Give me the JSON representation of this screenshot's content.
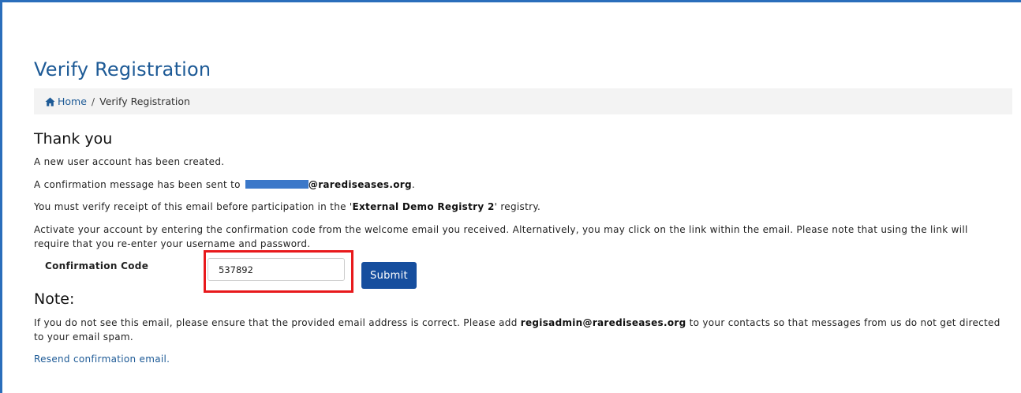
{
  "page": {
    "title": "Verify Registration"
  },
  "breadcrumb": {
    "home_label": "Home",
    "separator": "/",
    "current_label": "Verify Registration"
  },
  "thank_you": {
    "heading": "Thank you",
    "line1": "A new user account has been created.",
    "line2_prefix": "A confirmation message has been sent to ",
    "line2_email_visible": "@rarediseases.org",
    "line2_suffix": ".",
    "line3_prefix": "You must verify receipt of this email before participation in the '",
    "line3_registry": "External Demo Registry 2",
    "line3_suffix": "' registry.",
    "line4": "Activate your account by entering the confirmation code from the welcome email you received. Alternatively, you may click on the link within the email. Please note that using the link will require that you re-enter your username and password."
  },
  "form": {
    "code_label": "Confirmation Code",
    "code_value": "537892",
    "submit_label": "Submit"
  },
  "note": {
    "heading": "Note:",
    "text_prefix": "If you do not see this email, please ensure that the provided email address is correct. Please add ",
    "admin_email": "regisadmin@rarediseases.org",
    "text_suffix": " to your contacts so that messages from us do not get directed to your email spam.",
    "resend_link": "Resend confirmation email."
  },
  "colors": {
    "title": "#1d5a96",
    "frame_border": "#2a6ebb",
    "submit_bg": "#164e9e",
    "highlight": "#e8191c"
  },
  "icons": {
    "home": "home-icon"
  }
}
